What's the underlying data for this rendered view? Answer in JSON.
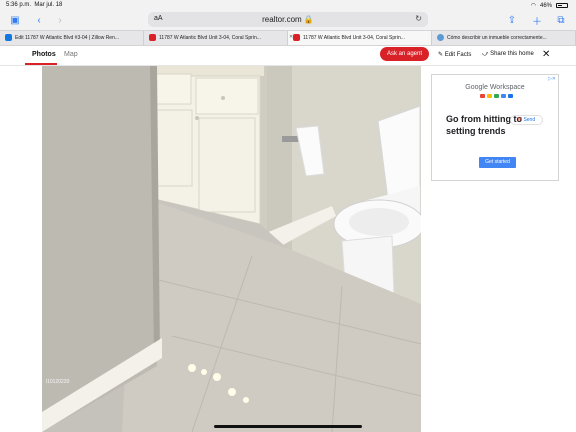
{
  "status": {
    "time": "5:36 p.m.",
    "date": "Mar jul. 18",
    "battery": "46%"
  },
  "browser": {
    "aa": "aA",
    "url": "realtor.com"
  },
  "tabs": [
    {
      "title": "Edit 11787 W Atlantic Blvd #3-04 | Zillow Ren..."
    },
    {
      "title": "11787 W Atlantic Blvd Unit 3-04, Coral Sprin..."
    },
    {
      "title": "11787 W Atlantic Blvd Unit 3-04, Coral Sprin..."
    },
    {
      "title": "Cómo describir un inmueble correctamente..."
    }
  ],
  "page_nav": {
    "photos": "Photos",
    "map": "Map",
    "ask_agent": "Ask an agent",
    "edit_facts": "Edit Facts",
    "share": "Share this home"
  },
  "ad": {
    "brand": "Google Workspace",
    "headline": "Go from hitting      to setting trends",
    "send": "Send",
    "cta": "Get started"
  },
  "watermark": "l10120230",
  "colors": {
    "accent": "#d92228",
    "link": "#2f7cf6"
  }
}
